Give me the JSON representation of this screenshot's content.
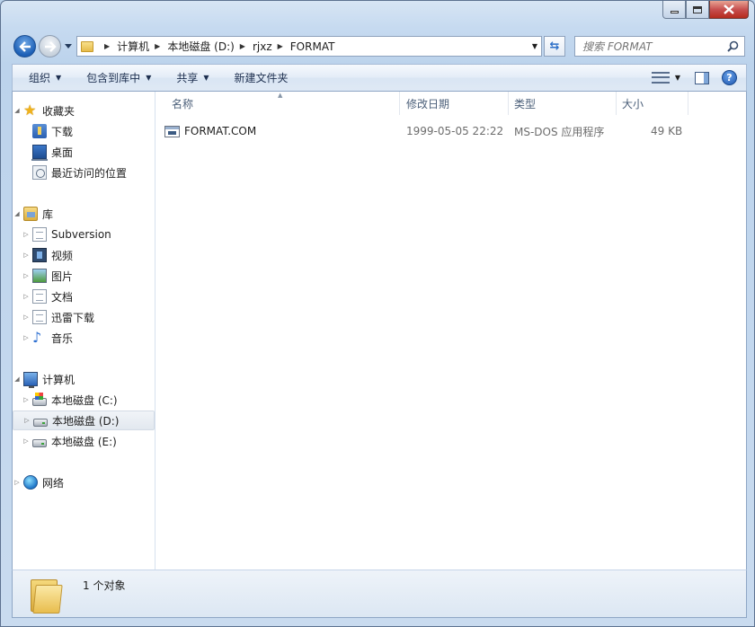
{
  "window": {
    "caption": {
      "minimize": "minimize",
      "maximize": "maximize",
      "close": "close"
    }
  },
  "address": {
    "crumbs": [
      "计算机",
      "本地磁盘 (D:)",
      "rjxz",
      "FORMAT"
    ],
    "search_placeholder": "搜索 FORMAT"
  },
  "toolbar": {
    "organize": "组织",
    "include_in_library": "包含到库中",
    "share": "共享",
    "new_folder": "新建文件夹"
  },
  "nav": {
    "favorites": {
      "label": "收藏夹",
      "items": [
        "下载",
        "桌面",
        "最近访问的位置"
      ]
    },
    "libraries": {
      "label": "库",
      "items": [
        "Subversion",
        "视频",
        "图片",
        "文档",
        "迅雷下载",
        "音乐"
      ]
    },
    "computer": {
      "label": "计算机",
      "items": [
        "本地磁盘 (C:)",
        "本地磁盘 (D:)",
        "本地磁盘 (E:)"
      ],
      "selected": "本地磁盘 (D:)"
    },
    "network": {
      "label": "网络"
    }
  },
  "columns": {
    "name": "名称",
    "modified": "修改日期",
    "type": "类型",
    "size": "大小"
  },
  "files": [
    {
      "name": "FORMAT.COM",
      "modified": "1999-05-05 22:22",
      "type": "MS-DOS 应用程序",
      "size": "49 KB"
    }
  ],
  "status": {
    "text": "1 个对象"
  },
  "colors": {
    "window_frame": "#c6daf0",
    "selection": "#e2e8ef",
    "close_button": "#c75050",
    "header_text": "#4c607a"
  }
}
